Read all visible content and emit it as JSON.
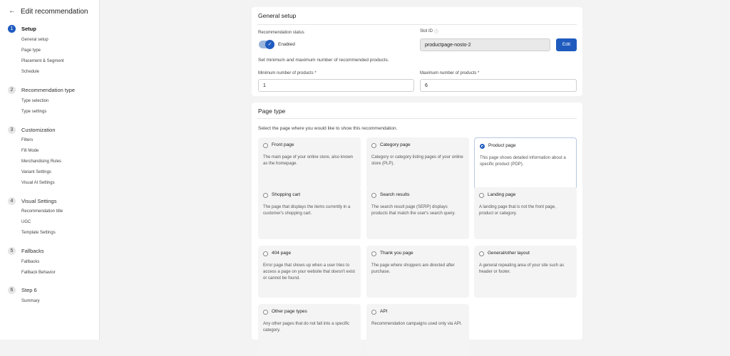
{
  "sidebar": {
    "back_icon": "←",
    "title": "Edit recommendation",
    "steps": [
      {
        "num": "1",
        "label": "Setup",
        "subs": [
          "General setup",
          "Page type",
          "Placement & Segment",
          "Schedule"
        ]
      },
      {
        "num": "2",
        "label": "Recommendation type",
        "subs": [
          "Type selection",
          "Type settings"
        ]
      },
      {
        "num": "3",
        "label": "Customization",
        "subs": [
          "Filters",
          "Fill Mode",
          "Merchandising Rules",
          "Variant Settings",
          "Visual AI Settings"
        ]
      },
      {
        "num": "4",
        "label": "Visual Settings",
        "subs": [
          "Recommendation title",
          "UGC",
          "Template Settings"
        ]
      },
      {
        "num": "5",
        "label": "Fallbacks",
        "subs": [
          "Fallbacks",
          "Fallback Behavior"
        ]
      },
      {
        "num": "6",
        "label": "Step 6",
        "subs": [
          "Summary"
        ]
      }
    ]
  },
  "general": {
    "title": "General setup",
    "status_label": "Recommendation status",
    "status_value": "Enabled",
    "slot_label": "Slot ID",
    "info_icon": "ⓘ",
    "slot_value": "productpage-nosto-2",
    "edit_label": "Edit",
    "hint": "Set minimum and maximum number of recommended products.",
    "min_label": "Minimum number of products *",
    "min_value": "1",
    "max_label": "Maximum number of products *",
    "max_value": "6"
  },
  "page_type": {
    "title": "Page type",
    "hint": "Select the page where you would like to show this recommendation.",
    "options": [
      {
        "title": "Front page",
        "desc": "The main page of your online store, also known as the homepage.",
        "selected": false
      },
      {
        "title": "Category page",
        "desc": "Category or category listing pages of your online store (PLP).",
        "selected": false
      },
      {
        "title": "Product page",
        "desc": "This page shows detailed information about a specific product (PDP).",
        "selected": true
      },
      {
        "title": "Shopping cart",
        "desc": "The page that displays the items currently in a customer's shopping cart.",
        "selected": false
      },
      {
        "title": "Search results",
        "desc": "The search result page (SERP) displays products that match the user's search query.",
        "selected": false
      },
      {
        "title": "Landing page",
        "desc": "A landing page that is not the front page, product or category.",
        "selected": false
      },
      {
        "title": "404 page",
        "desc": "Error page that shows up when a user tries to access a page on your website that doesn't exist or cannot be found.",
        "selected": false
      },
      {
        "title": "Thank you page",
        "desc": "The page where shoppers are directed after purchase.",
        "selected": false
      },
      {
        "title": "General/other layout",
        "desc": "A general repeating area of your site such as header or footer.",
        "selected": false
      },
      {
        "title": "Other page types",
        "desc": "Any other pages that do not fall into a specific category.",
        "selected": false
      },
      {
        "title": "API",
        "desc": "Recommendation campaigns used only via API.",
        "selected": false
      }
    ]
  },
  "colors": {
    "accent": "#1f5bbf",
    "background": "#f3f3f3"
  }
}
